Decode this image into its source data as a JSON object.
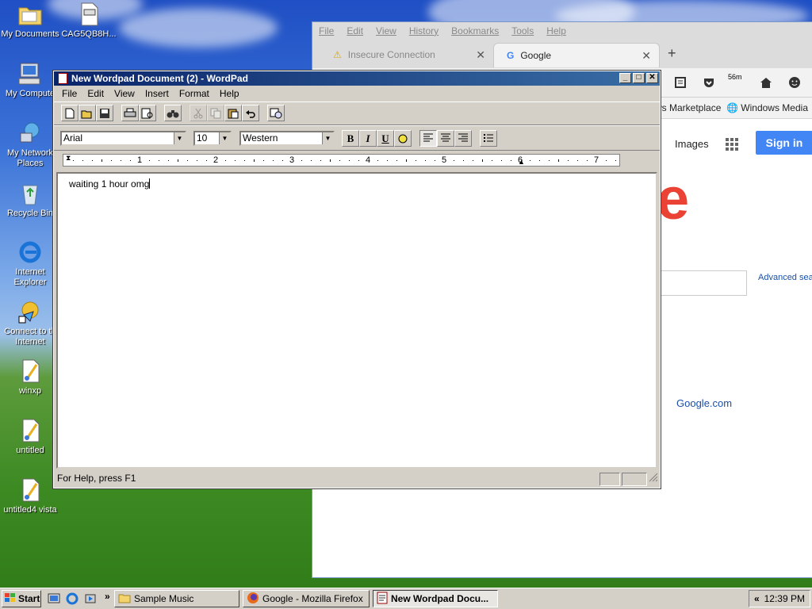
{
  "desktop": {
    "icons": [
      {
        "label": "My Documents",
        "icon": "folder-documents-icon"
      },
      {
        "label": "CAG5QB8H...",
        "icon": "file-icon"
      },
      {
        "label": "My Compute",
        "icon": "computer-icon"
      },
      {
        "label": "My Network",
        "label2": "Places",
        "icon": "network-icon"
      },
      {
        "label": "Recycle Bin",
        "icon": "recycle-bin-icon"
      },
      {
        "label": "Internet",
        "label2": "Explorer",
        "icon": "ie-icon"
      },
      {
        "label": "Connect to th",
        "label2": "Internet",
        "icon": "connect-icon"
      },
      {
        "label": "winxp",
        "icon": "paint-file-icon"
      },
      {
        "label": "untitled",
        "icon": "paint-file-icon"
      },
      {
        "label": "untitled4 vista",
        "icon": "paint-file-icon"
      }
    ]
  },
  "firefox": {
    "menu": [
      "File",
      "Edit",
      "View",
      "History",
      "Bookmarks",
      "Tools",
      "Help"
    ],
    "tabs": [
      {
        "label": "Insecure Connection",
        "icon": "warning-icon",
        "active": false
      },
      {
        "label": "Google",
        "icon": "google-icon",
        "active": true
      }
    ],
    "new_tab": "+",
    "toolbar_badge": "56m",
    "bookmarks": [
      "ws Marketplace",
      "Windows Media"
    ],
    "page": {
      "images_link": "Images",
      "sign_in": "Sign in",
      "logo_fragment": "e",
      "advanced_search": "Advanced sea",
      "footer_link": "Google.com"
    },
    "colors": {
      "sign_in_bg": "#4285f4",
      "logo_red": "#ea4335"
    }
  },
  "wordpad": {
    "title": "New Wordpad Document (2) - WordPad",
    "menu": [
      "File",
      "Edit",
      "View",
      "Insert",
      "Format",
      "Help"
    ],
    "font_name": "Arial",
    "font_size": "10",
    "script": "Western",
    "format_buttons": {
      "bold": "B",
      "italic": "I",
      "underline": "U"
    },
    "ruler_labels": [
      "1",
      "2",
      "3",
      "4",
      "5",
      "6",
      "7"
    ],
    "document_text": "waiting 1 hour omg",
    "status_text": "For Help, press F1"
  },
  "taskbar": {
    "start_label": "Start",
    "quicklaunch_more": "»",
    "tasks": [
      {
        "label": "Sample Music",
        "icon": "folder-icon",
        "active": false
      },
      {
        "label": "Google - Mozilla Firefox",
        "icon": "firefox-icon",
        "active": false
      },
      {
        "label": "New Wordpad Docu...",
        "icon": "wordpad-icon",
        "active": true
      }
    ],
    "tray_arrow": "«",
    "clock": "12:39 PM"
  }
}
